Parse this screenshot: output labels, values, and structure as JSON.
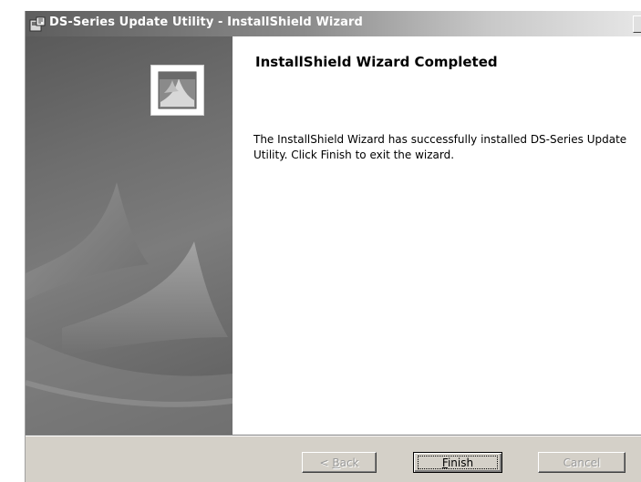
{
  "window": {
    "title": "DS-Series Update Utility - InstallShield Wizard",
    "icon": "installer-icon"
  },
  "side_panel": {
    "logo": "installshield-logo"
  },
  "content": {
    "heading": "InstallShield Wizard Completed",
    "message": "The InstallShield Wizard has successfully installed DS-Series Update Utility. Click Finish to exit the wizard."
  },
  "buttons": {
    "back": {
      "label_pre": "< ",
      "accel": "B",
      "label_post": "ack",
      "enabled": false
    },
    "finish": {
      "accel": "F",
      "label_post": "inish",
      "enabled": true
    },
    "cancel": {
      "label": "Cancel",
      "enabled": false
    }
  }
}
